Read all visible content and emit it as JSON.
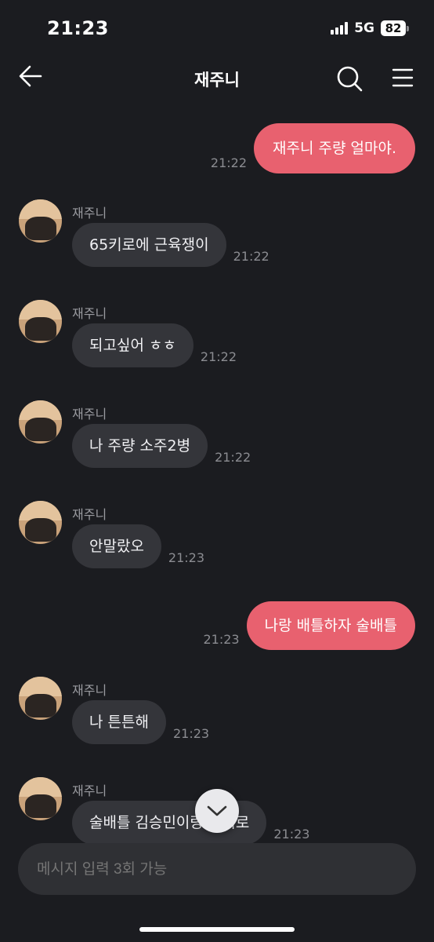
{
  "status": {
    "time": "21:23",
    "network": "5G",
    "battery": "82"
  },
  "header": {
    "title": "재주니"
  },
  "messages": [
    {
      "dir": "out",
      "text": "재주니 주량 얼마야.",
      "time": "21:22"
    },
    {
      "dir": "in",
      "sender": "재주니",
      "text": "65키로에 근육쟁이",
      "time": "21:22"
    },
    {
      "dir": "in",
      "sender": "재주니",
      "text": "되고싶어 ㅎㅎ",
      "time": "21:22"
    },
    {
      "dir": "in",
      "sender": "재주니",
      "text": "나 주량 소주2병",
      "time": "21:22"
    },
    {
      "dir": "in",
      "sender": "재주니",
      "text": "안말랐오",
      "time": "21:23"
    },
    {
      "dir": "out",
      "text": "나랑 배틀하자 술배틀",
      "time": "21:23"
    },
    {
      "dir": "in",
      "sender": "재주니",
      "text": "나 튼튼해",
      "time": "21:23"
    },
    {
      "dir": "in",
      "sender": "재주니",
      "text": "술배틀 김승민이랑 한뒤로",
      "time": "21:23"
    }
  ],
  "input": {
    "placeholder": "메시지 입력 3회 가능"
  },
  "icons": {
    "back": "arrow-left-icon",
    "search": "search-icon",
    "menu": "hamburger-menu-icon",
    "scroll_down": "chevron-down-icon"
  },
  "colors": {
    "background": "#1b1c20",
    "outgoing_bubble": "#e8616f",
    "incoming_bubble": "#34353a"
  }
}
